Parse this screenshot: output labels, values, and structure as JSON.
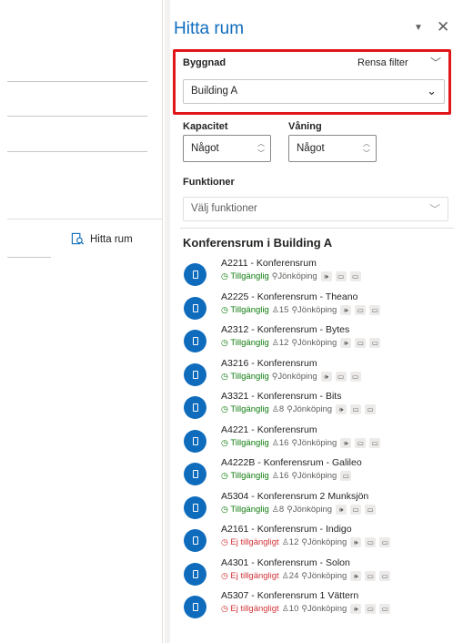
{
  "left": {
    "find_room_label": "Hitta rum"
  },
  "panel": {
    "title": "Hitta rum",
    "building_label": "Byggnad",
    "clear_filter": "Rensa filter",
    "building_value": "Building A",
    "capacity_label": "Kapacitet",
    "capacity_value": "Något",
    "floor_label": "Våning",
    "floor_value": "Något",
    "functions_label": "Funktioner",
    "functions_placeholder": "Välj funktioner",
    "list_title": "Konferensrum i Building A"
  },
  "colors": {
    "accent": "#0f6cbd",
    "highlight": "#e0161b",
    "available": "#107c10",
    "unavailable": "#d13438"
  },
  "rooms": [
    {
      "name": "A2211 - Konferensrum",
      "status": "Tillgänglig",
      "available": true,
      "capacity": "",
      "location": "Jönköping",
      "features": [
        "audio",
        "display",
        "camera"
      ]
    },
    {
      "name": "A2225 - Konferensrum - Theano",
      "status": "Tillgänglig",
      "available": true,
      "capacity": "15",
      "location": "Jönköping",
      "features": [
        "audio",
        "display",
        "camera"
      ]
    },
    {
      "name": "A2312 - Konferensrum - Bytes",
      "status": "Tillgänglig",
      "available": true,
      "capacity": "12",
      "location": "Jönköping",
      "features": [
        "audio",
        "display",
        "camera"
      ]
    },
    {
      "name": "A3216 - Konferensrum",
      "status": "Tillgänglig",
      "available": true,
      "capacity": "",
      "location": "Jönköping",
      "features": [
        "audio",
        "display",
        "camera"
      ]
    },
    {
      "name": "A3321 - Konferensrum - Bits",
      "status": "Tillgänglig",
      "available": true,
      "capacity": "8",
      "location": "Jönköping",
      "features": [
        "audio",
        "display",
        "camera"
      ]
    },
    {
      "name": "A4221 - Konferensrum",
      "status": "Tillgänglig",
      "available": true,
      "capacity": "16",
      "location": "Jönköping",
      "features": [
        "audio",
        "display",
        "camera"
      ]
    },
    {
      "name": "A4222B - Konferensrum - Galileo",
      "status": "Tillgänglig",
      "available": true,
      "capacity": "16",
      "location": "Jönköping",
      "features": [
        "display"
      ]
    },
    {
      "name": "A5304 - Konferensrum 2 Munksjön",
      "status": "Tillgänglig",
      "available": true,
      "capacity": "8",
      "location": "Jönköping",
      "features": [
        "audio",
        "display",
        "camera"
      ]
    },
    {
      "name": "A2161 - Konferensrum - Indigo",
      "status": "Ej tillgängligt",
      "available": false,
      "capacity": "12",
      "location": "Jönköping",
      "features": [
        "audio",
        "display",
        "camera"
      ]
    },
    {
      "name": "A4301 - Konferensrum - Solon",
      "status": "Ej tillgängligt",
      "available": false,
      "capacity": "24",
      "location": "Jönköping",
      "features": [
        "audio",
        "display",
        "camera"
      ]
    },
    {
      "name": "A5307 - Konferensrum 1 Vättern",
      "status": "Ej tillgängligt",
      "available": false,
      "capacity": "10",
      "location": "Jönköping",
      "features": [
        "audio",
        "display",
        "camera"
      ]
    }
  ]
}
